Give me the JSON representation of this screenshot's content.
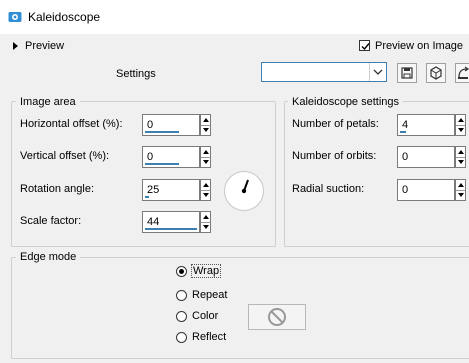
{
  "window": {
    "title": "Kaleidoscope"
  },
  "top": {
    "preview_label": "Preview",
    "preview_on_image_label": "Preview on Image",
    "settings_label": "Settings",
    "settings_value": ""
  },
  "image_area": {
    "legend": "Image area",
    "horizontal_offset_label": "Horizontal offset (%):",
    "horizontal_offset_value": "0",
    "vertical_offset_label": "Vertical offset (%):",
    "vertical_offset_value": "0",
    "rotation_angle_label": "Rotation angle:",
    "rotation_angle_value": "25",
    "scale_factor_label": "Scale factor:",
    "scale_factor_value": "44"
  },
  "kaleidoscope_settings": {
    "legend": "Kaleidoscope settings",
    "petals_label": "Number of petals:",
    "petals_value": "4",
    "orbits_label": "Number of orbits:",
    "orbits_value": "0",
    "radial_suction_label": "Radial suction:",
    "radial_suction_value": "0"
  },
  "edge_mode": {
    "legend": "Edge mode",
    "options": [
      "Wrap",
      "Repeat",
      "Color",
      "Reflect"
    ],
    "selected": "Wrap"
  },
  "colors": {
    "accent": "#3c7fb1",
    "title_icon": "#2f8fd6"
  },
  "icons": [
    "kaleidoscope-app-icon",
    "expand-caret-icon",
    "checkbox-checked-icon",
    "chevron-down-icon",
    "save-preset-icon",
    "cube-preset-icon",
    "reset-icon",
    "rotation-dial-icon",
    "no-color-icon"
  ]
}
